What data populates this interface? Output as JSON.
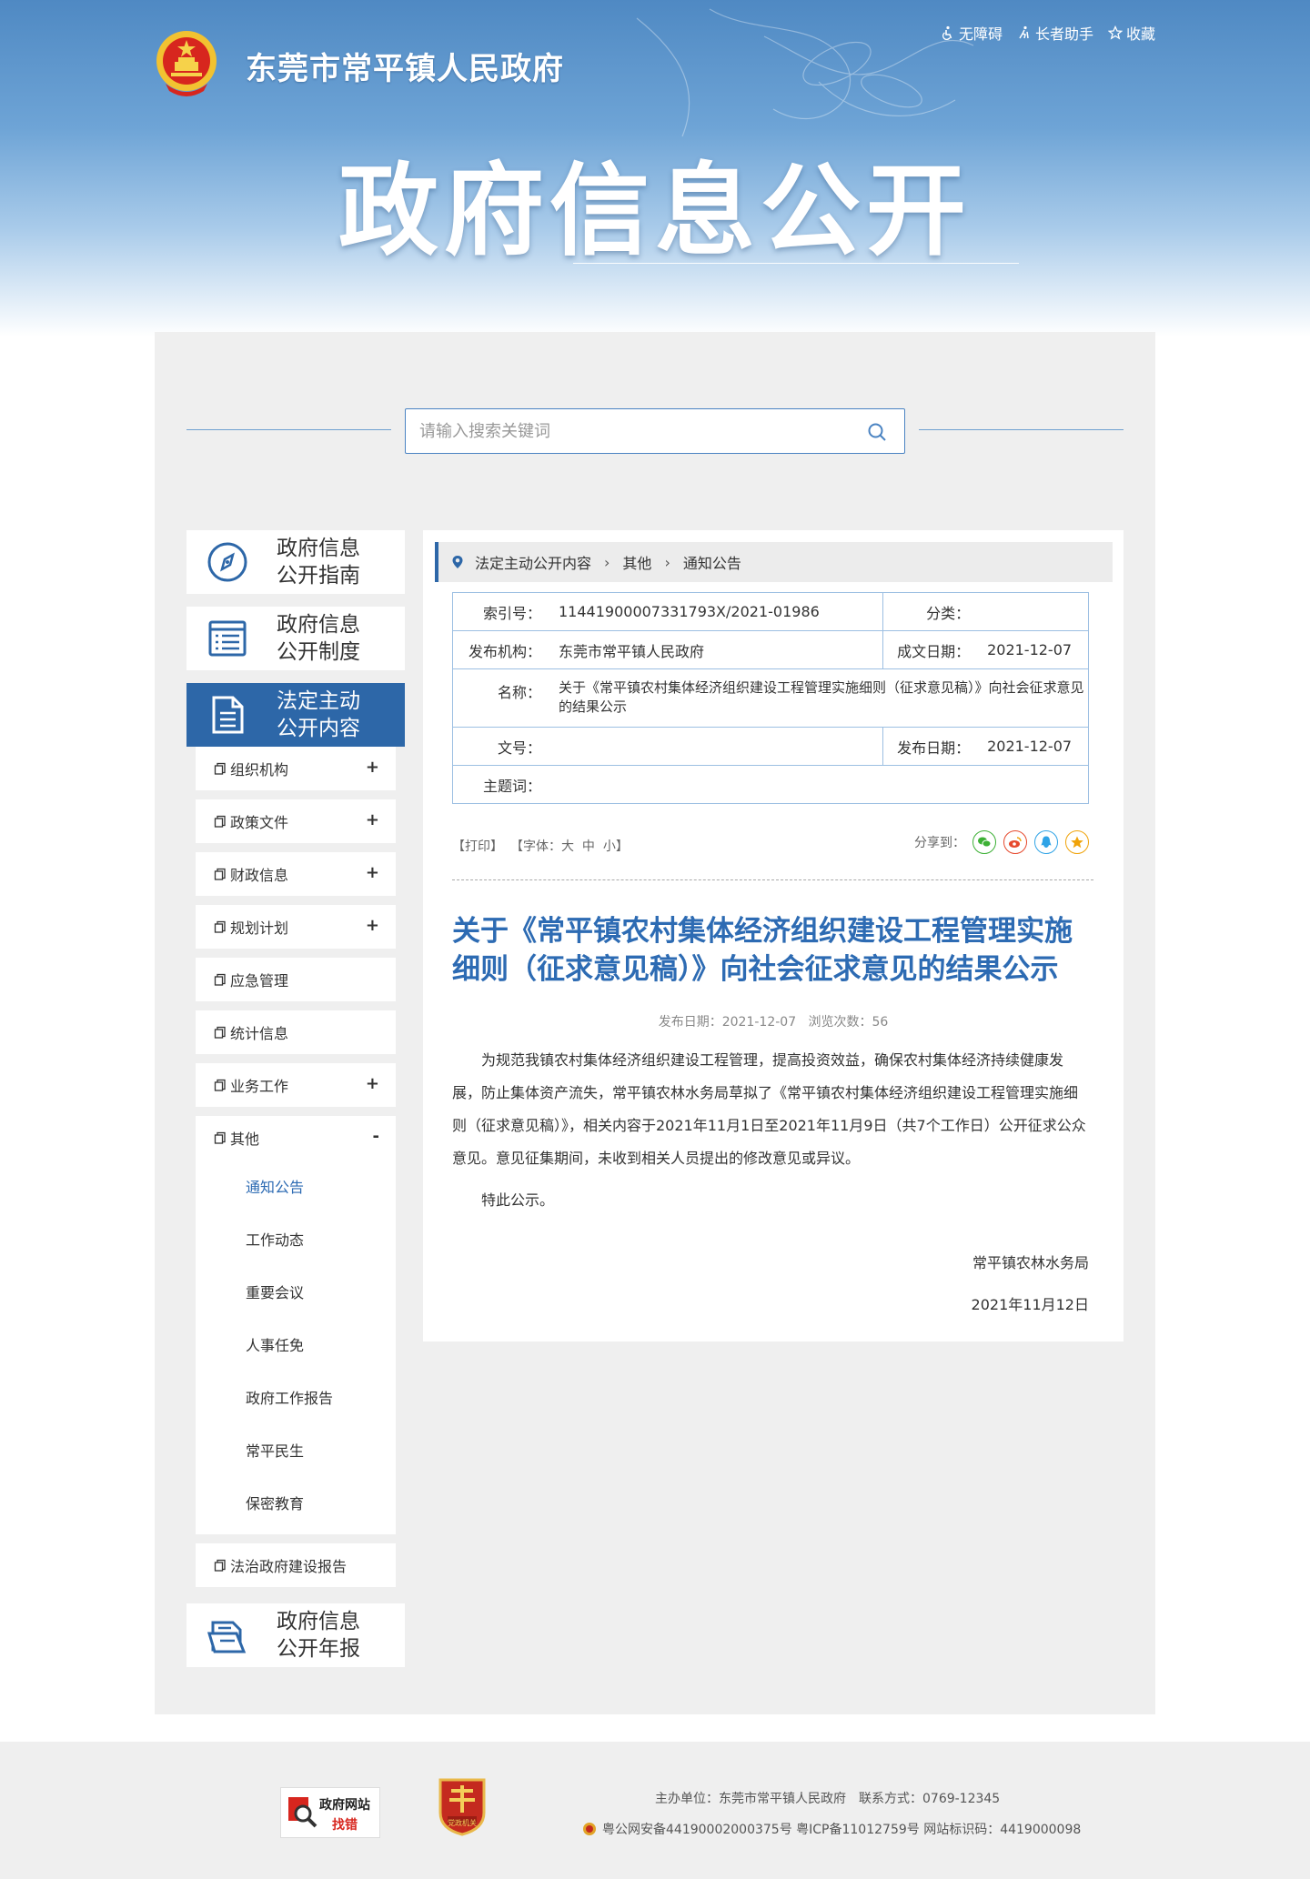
{
  "header": {
    "site_name": "东莞市常平镇人民政府",
    "big_title": "政府信息公开",
    "tools": [
      {
        "label": "无障碍",
        "icon": "accessibility-icon"
      },
      {
        "label": "长者助手",
        "icon": "elder-helper-icon"
      },
      {
        "label": "收藏",
        "icon": "star-icon"
      }
    ]
  },
  "search": {
    "placeholder": "请输入搜索关键词"
  },
  "sidebar": {
    "guide": {
      "line1": "政府信息",
      "line2": "公开指南"
    },
    "system": {
      "line1": "政府信息",
      "line2": "公开制度"
    },
    "content": {
      "line1": "法定主动",
      "line2": "公开内容"
    },
    "annual": {
      "line1": "政府信息",
      "line2": "公开年报"
    },
    "items": [
      {
        "label": "组织机构",
        "toggle": "+"
      },
      {
        "label": "政策文件",
        "toggle": "+"
      },
      {
        "label": "财政信息",
        "toggle": "+"
      },
      {
        "label": "规划计划",
        "toggle": "+"
      },
      {
        "label": "应急管理",
        "toggle": ""
      },
      {
        "label": "统计信息",
        "toggle": ""
      },
      {
        "label": "业务工作",
        "toggle": "+"
      }
    ],
    "other": {
      "label": "其他",
      "toggle": "-",
      "children": [
        "通知公告",
        "工作动态",
        "重要会议",
        "人事任免",
        "政府工作报告",
        "常平民生",
        "保密教育"
      ]
    },
    "last_item": {
      "label": "法治政府建设报告"
    }
  },
  "breadcrumb": [
    "法定主动公开内容",
    "其他",
    "通知公告"
  ],
  "meta": {
    "index_label": "索引号：",
    "index_value": "11441900007331793X/2021-01986",
    "category_label": "分类：",
    "category_value": "",
    "publisher_label": "发布机构：",
    "publisher_value": "东莞市常平镇人民政府",
    "created_label": "成文日期：",
    "created_value": "2021-12-07",
    "name_label": "名称：",
    "name_value": "关于《常平镇农村集体经济组织建设工程管理实施细则（征求意见稿）》向社会征求意见的结果公示",
    "docno_label": "文号：",
    "docno_value": "",
    "published_label": "发布日期：",
    "published_value": "2021-12-07",
    "subject_label": "主题词：",
    "subject_value": ""
  },
  "tools": {
    "print": "【打印】",
    "font_prefix": "【字体：",
    "font_large": "大",
    "font_medium": "中",
    "font_small": "小",
    "font_suffix": "】",
    "share_label": "分享到：",
    "share": [
      {
        "icon": "wechat-icon",
        "color": "#3cb035"
      },
      {
        "icon": "weibo-icon",
        "color": "#e6492d"
      },
      {
        "icon": "qq-icon",
        "color": "#2fa3e6"
      },
      {
        "icon": "qzone-icon",
        "color": "#f0a30a"
      }
    ]
  },
  "article": {
    "title": "关于《常平镇农村集体经济组织建设工程管理实施细则（征求意见稿）》向社会征求意见的结果公示",
    "meta": "发布日期：2021-12-07   浏览次数：56",
    "paragraph1": "为规范我镇农村集体经济组织建设工程管理，提高投资效益，确保农村集体经济持续健康发展，防止集体资产流失，常平镇农林水务局草拟了《常平镇农村集体经济组织建设工程管理实施细则（征求意见稿）》，相关内容于2021年11月1日至2021年11月9日（共7个工作日）公开征求公众意见。意见征集期间，未收到相关人员提出的修改意见或异议。",
    "paragraph2": "特此公示。",
    "signature": "常平镇农林水务局",
    "date": "2021年11月12日"
  },
  "footer": {
    "badge_find_line1": "政府网站",
    "badge_find_line2": "找错",
    "badge_party": "党政机关",
    "host": "主办单位：东莞市常平镇人民政府　联系方式：0769-12345",
    "records": "粤公网安备44190002000375号 粤ICP备11012759号 网站标识码：4419000098"
  },
  "colors": {
    "primary": "#2d67a8",
    "title": "#2d6bb3",
    "panel": "#efefef"
  }
}
